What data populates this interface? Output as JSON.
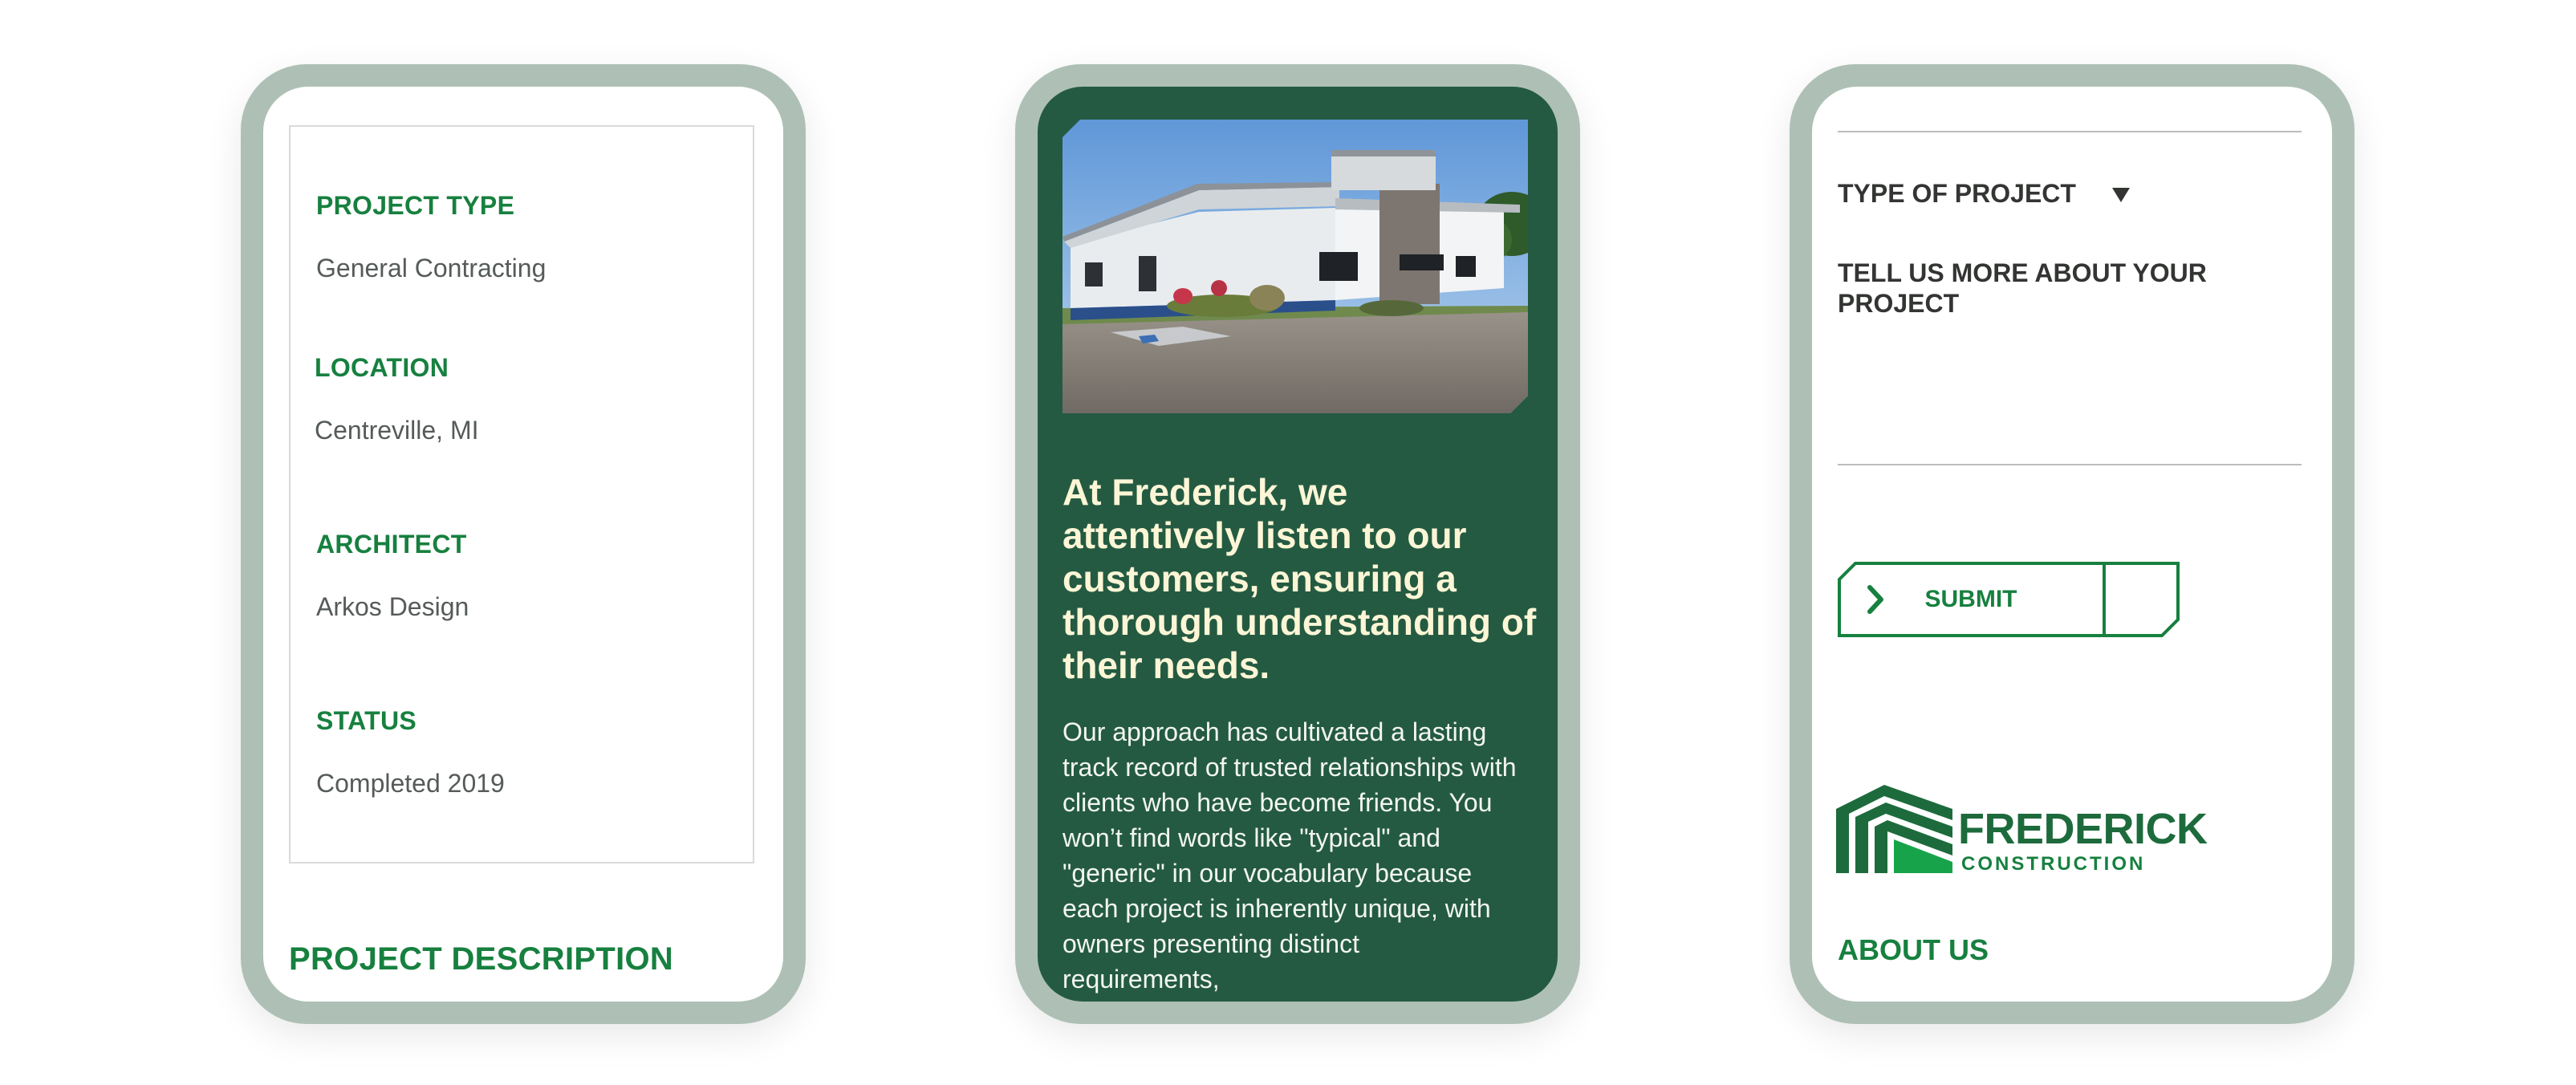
{
  "project_details": {
    "items": [
      {
        "label": "PROJECT TYPE",
        "value": "General Contracting"
      },
      {
        "label": "LOCATION",
        "value": "Centreville, MI"
      },
      {
        "label": "ARCHITECT",
        "value": "Arkos Design"
      },
      {
        "label": "STATUS",
        "value": "Completed 2019"
      }
    ],
    "description_heading": "PROJECT DESCRIPTION"
  },
  "about_section": {
    "heading": "At Frederick, we attentively listen to our customers, ensuring a thorough understanding of their needs.",
    "body": "Our approach has cultivated a lasting track record of trusted relationships with clients who have become friends. You won’t find words like \"typical\" and \"generic\" in our vocabulary because each project is inherently unique, with owners presenting distinct requirements,"
  },
  "contact_form": {
    "type_select_label": "TYPE OF PROJECT",
    "more_label": "TELL US MORE ABOUT YOUR PROJECT",
    "submit_label": "SUBMIT"
  },
  "footer": {
    "logo_name": "FREDERICK",
    "logo_sub": "CONSTRUCTION",
    "about_link": "ABOUT US"
  },
  "colors": {
    "brand_green": "#17803f",
    "dark_green": "#245a42",
    "frame": "#aec0b5",
    "cream": "#fcf6d6"
  },
  "icons": [
    "caret-down-icon",
    "chevron-right-icon",
    "frederick-logo-mark"
  ]
}
